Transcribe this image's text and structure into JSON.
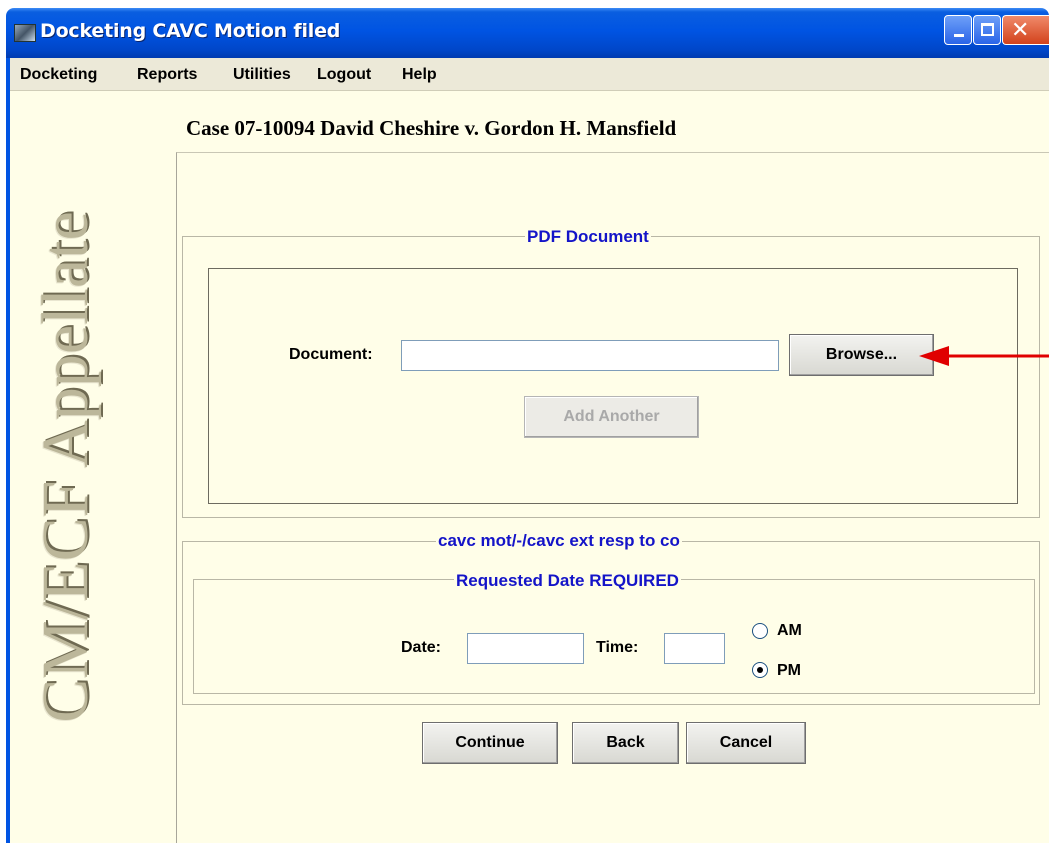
{
  "window": {
    "title": "Docketing CAVC Motion filed"
  },
  "menu": {
    "items": [
      "Docketing",
      "Reports",
      "Utilities",
      "Logout",
      "Help"
    ]
  },
  "sidebar": {
    "branding": "CM/ECF Appellate"
  },
  "case": {
    "title": "Case 07-10094 David Cheshire v. Gordon H. Mansfield"
  },
  "pdf_group": {
    "legend": "PDF Document",
    "document_label": "Document:",
    "document_value": "",
    "browse_label": "Browse...",
    "add_another_label": "Add Another"
  },
  "event_group": {
    "legend": "cavc mot/-/cavc ext resp to co",
    "requested_legend": "Requested Date REQUIRED",
    "date_label": "Date:",
    "date_value": "",
    "time_label": "Time:",
    "time_value": "",
    "am_label": "AM",
    "pm_label": "PM",
    "selected_period": "PM"
  },
  "actions": {
    "continue_label": "Continue",
    "back_label": "Back",
    "cancel_label": "Cancel"
  },
  "colors": {
    "titlebar": "#0054e3",
    "content_background": "#fffee8",
    "legend_text": "#1414c8",
    "annotation_arrow": "#e00000"
  }
}
